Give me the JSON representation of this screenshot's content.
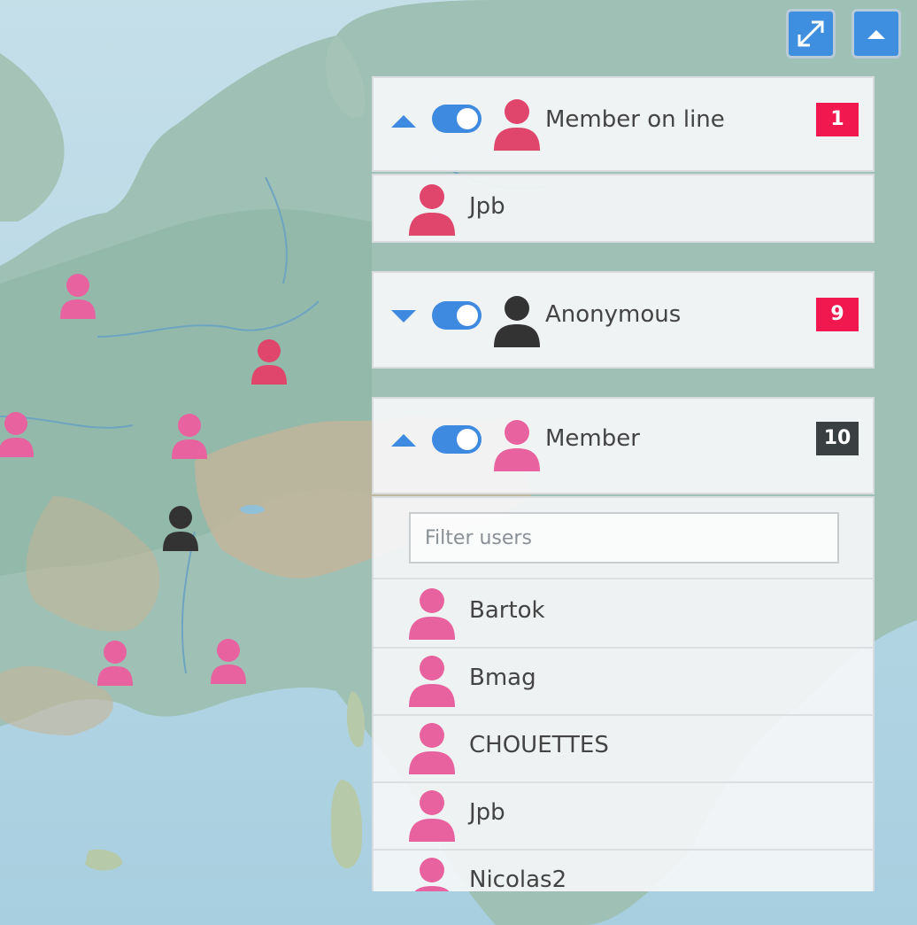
{
  "controls": {
    "fullscreen_icon": "expand-arrows-icon",
    "collapse_icon": "caret-up-icon"
  },
  "groups": [
    {
      "label": "Member on line",
      "count": "1",
      "expanded": true,
      "toggle_on": true,
      "icon_color": "#e0456b",
      "badge_color": "#f0184e",
      "users": [
        {
          "name": "Jpb"
        }
      ]
    },
    {
      "label": "Anonymous",
      "count": "9",
      "expanded": false,
      "toggle_on": true,
      "icon_color": "#333333",
      "badge_color": "#f0184e",
      "users": []
    },
    {
      "label": "Member",
      "count": "10",
      "expanded": true,
      "toggle_on": true,
      "icon_color": "#e8629f",
      "badge_color": "#3a3f42",
      "filter_placeholder": "Filter users",
      "users": [
        {
          "name": "Bartok"
        },
        {
          "name": "Bmag"
        },
        {
          "name": "CHOUETTES"
        },
        {
          "name": "Jpb"
        },
        {
          "name": "Nicolas2"
        }
      ]
    }
  ],
  "map": {
    "markers": [
      {
        "type": "member",
        "color": "#e8629f"
      },
      {
        "type": "member-online",
        "color": "#e0456b"
      },
      {
        "type": "member",
        "color": "#e8629f"
      },
      {
        "type": "member",
        "color": "#e8629f"
      },
      {
        "type": "anonymous",
        "color": "#333333"
      },
      {
        "type": "member",
        "color": "#e8629f"
      },
      {
        "type": "member",
        "color": "#e8629f"
      }
    ]
  }
}
